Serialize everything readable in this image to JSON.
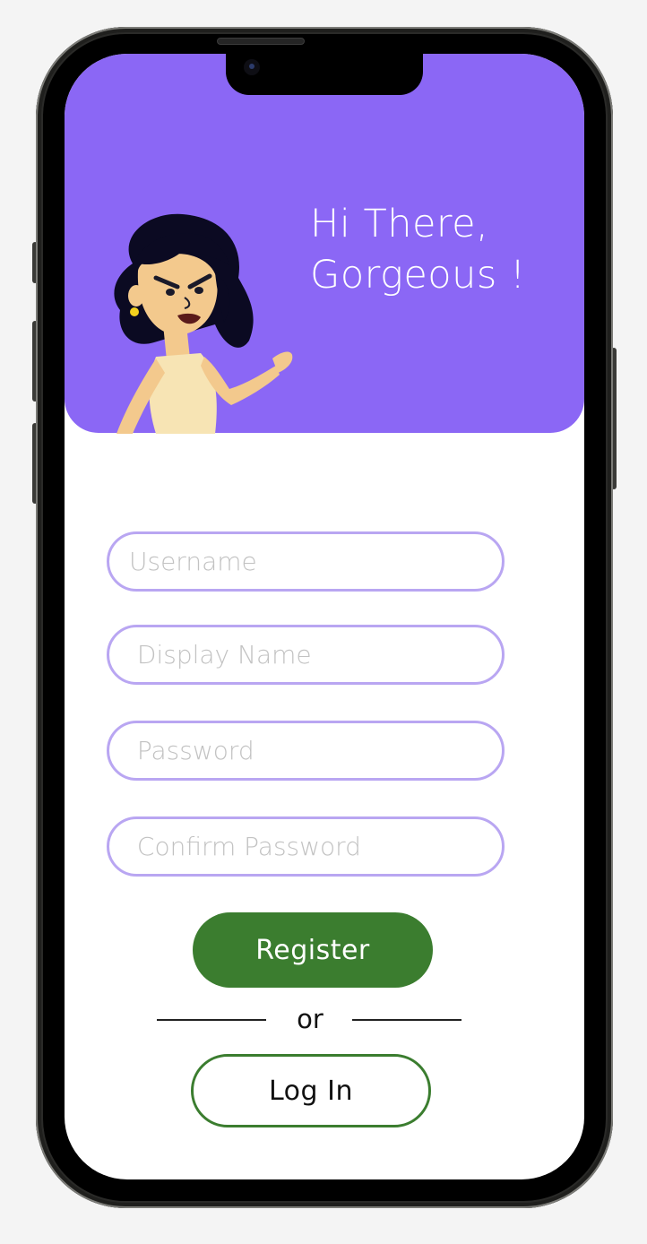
{
  "header": {
    "greeting_line1": "Hi There,",
    "greeting_line2": "Gorgeous !"
  },
  "form": {
    "username_placeholder": "Username",
    "display_name_placeholder": " Display Name",
    "password_placeholder": " Password",
    "confirm_password_placeholder": " Confirm Password"
  },
  "actions": {
    "register_label": "Register",
    "divider_label": "or",
    "login_label": "Log In"
  },
  "colors": {
    "header_bg": "#8b67f5",
    "input_border": "#b9a6f2",
    "primary_green": "#3b7d2f"
  }
}
